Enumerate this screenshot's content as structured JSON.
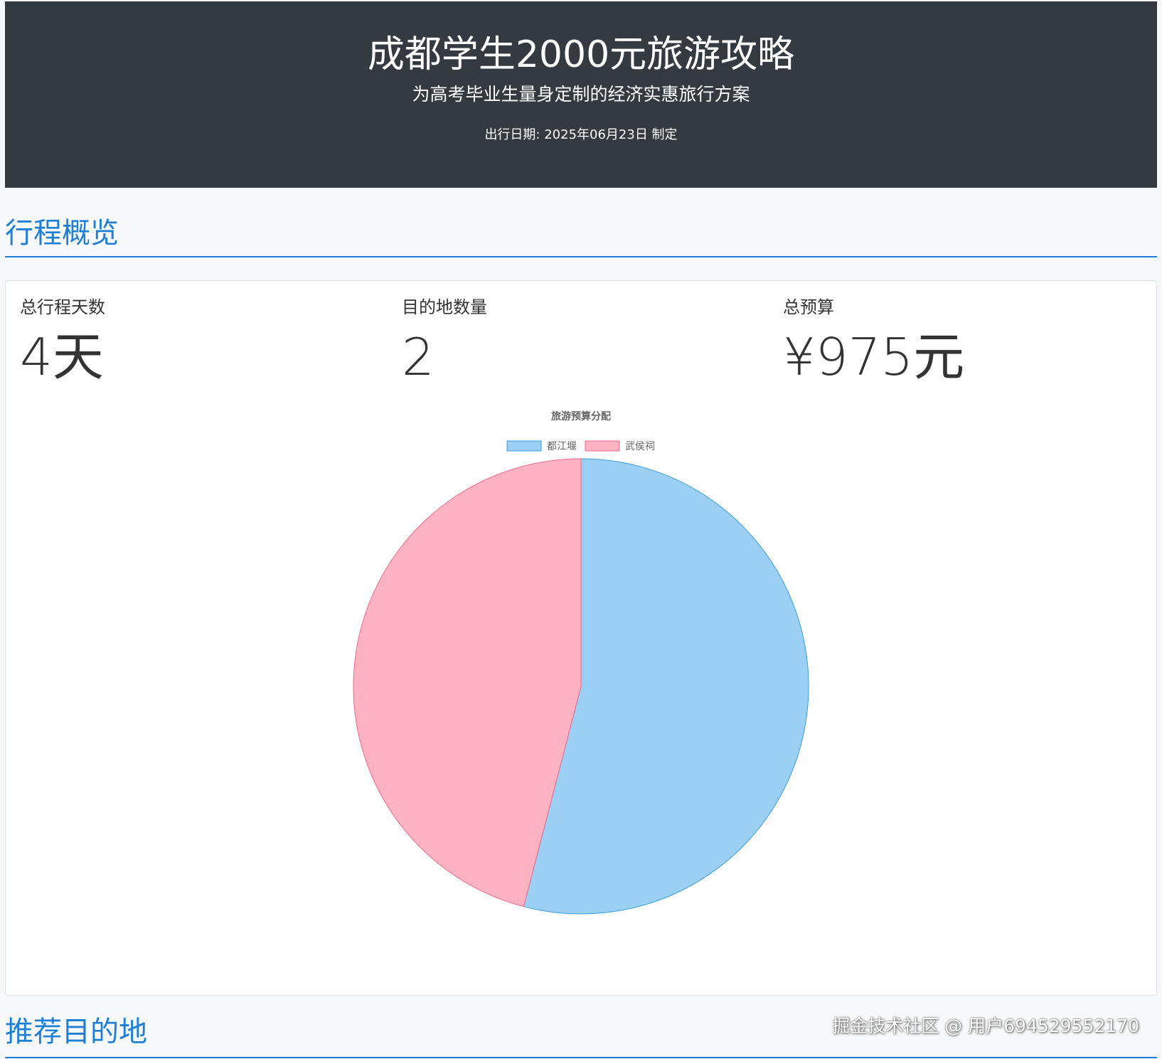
{
  "header": {
    "title": "成都学生2000元旅游攻略",
    "subtitle": "为高考毕业生量身定制的经济实惠旅行方案",
    "date_line": "出行日期: 2025年06月23日 制定"
  },
  "overview": {
    "section_title": "行程概览",
    "stats": [
      {
        "label": "总行程天数",
        "value": "4天"
      },
      {
        "label": "目的地数量",
        "value": "2"
      },
      {
        "label": "总预算",
        "value": "¥975元"
      }
    ]
  },
  "chart_data": {
    "type": "pie",
    "title": "旅游预算分配",
    "legend_position": "top",
    "categories": [
      "都江堰",
      "武侯祠"
    ],
    "values": [
      527,
      448
    ],
    "colors": [
      "#9bcff3",
      "#ffb3c2"
    ],
    "border_colors": [
      "#3a9ee0",
      "#ee6b8a"
    ]
  },
  "destinations": {
    "section_title": "推荐目的地"
  },
  "watermark": "掘金技术社区 @ 用户694529552170"
}
